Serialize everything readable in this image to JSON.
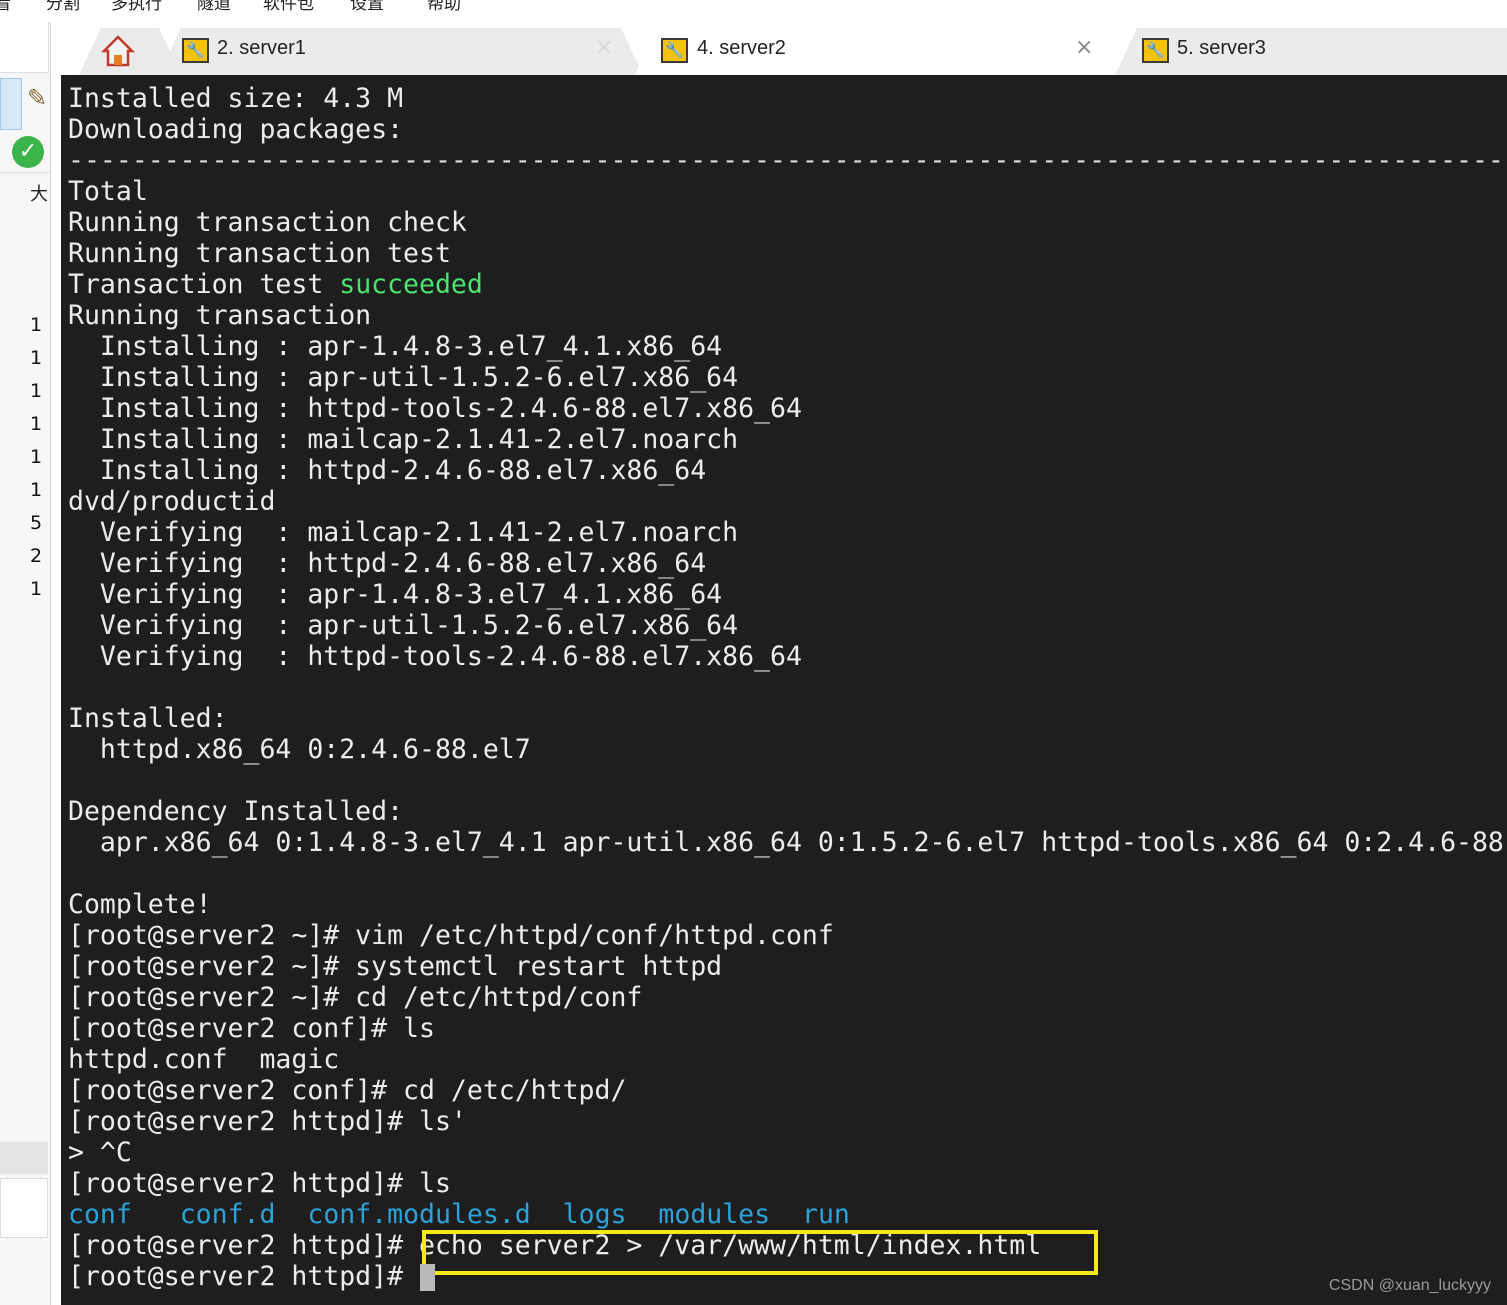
{
  "menu": {
    "items": [
      "看",
      "分割",
      "多执行",
      "隧道",
      "软件包",
      "设置",
      "帮助"
    ]
  },
  "left_panel": {
    "label_char": "大",
    "numbers": [
      "1",
      "1",
      "1",
      "1",
      "1",
      "1",
      "5",
      "2",
      "1"
    ]
  },
  "tabs": [
    {
      "label": "",
      "icon": "home-icon"
    },
    {
      "label": "2. server1",
      "icon": "wrench-icon",
      "close": "×"
    },
    {
      "label": "4. server2",
      "icon": "wrench-icon",
      "close": "×",
      "active": true
    },
    {
      "label": "5. server3",
      "icon": "wrench-icon"
    }
  ],
  "terminal": {
    "lines": [
      "Installed size: 4.3 M",
      "Downloading packages:",
      "--------------------------------------------------------------------------------------------------",
      "Total",
      "Running transaction check",
      "Running transaction test",
      "Transaction test ",
      "Running transaction",
      "  Installing : apr-1.4.8-3.el7_4.1.x86_64",
      "  Installing : apr-util-1.5.2-6.el7.x86_64",
      "  Installing : httpd-tools-2.4.6-88.el7.x86_64",
      "  Installing : mailcap-2.1.41-2.el7.noarch",
      "  Installing : httpd-2.4.6-88.el7.x86_64",
      "dvd/productid",
      "  Verifying  : mailcap-2.1.41-2.el7.noarch",
      "  Verifying  : httpd-2.4.6-88.el7.x86_64",
      "  Verifying  : apr-1.4.8-3.el7_4.1.x86_64",
      "  Verifying  : apr-util-1.5.2-6.el7.x86_64",
      "  Verifying  : httpd-tools-2.4.6-88.el7.x86_64",
      "Installed:",
      "  httpd.x86_64 0:2.4.6-88.el7",
      "Dependency Installed:",
      "  apr.x86_64 0:1.4.8-3.el7_4.1 apr-util.x86_64 0:1.5.2-6.el7 httpd-tools.x86_64 0:2.4.6-88",
      "Complete!",
      "[root@server2 ~]# vim /etc/httpd/conf/httpd.conf",
      "[root@server2 ~]# systemctl restart httpd",
      "[root@server2 ~]# cd /etc/httpd/conf",
      "[root@server2 conf]# ls",
      "httpd.conf  magic",
      "[root@server2 conf]# cd /etc/httpd/",
      "[root@server2 httpd]# ls'",
      "> ^C",
      "[root@server2 httpd]# ls",
      "[root@server2 httpd]# echo server2 > /var/www/html/index.html",
      "[root@server2 httpd]# "
    ],
    "succeeded_word": "succeeded",
    "ls_dirs": [
      "conf",
      "conf.d",
      "conf.modules.d",
      "logs",
      "modules",
      "run"
    ]
  },
  "watermark": "CSDN @xuan_luckyyy",
  "colors": {
    "terminal_bg": "#1e1e1e",
    "terminal_fg": "#ececec",
    "success_green": "#4ae56d",
    "dir_blue": "#2aa3dc",
    "highlight_yellow": "#f7e81a"
  }
}
